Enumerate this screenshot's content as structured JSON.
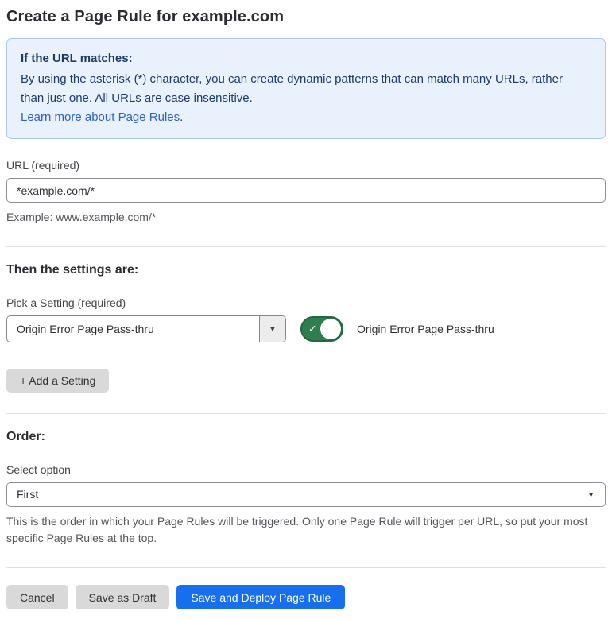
{
  "page": {
    "title": "Create a Page Rule for example.com"
  },
  "info_box": {
    "heading": "If the URL matches:",
    "body": "By using the asterisk (*) character, you can create dynamic patterns that can match many URLs, rather than just one. All URLs are case insensitive.",
    "link_label": "Learn more about Page Rules",
    "link_suffix": "."
  },
  "url_field": {
    "label": "URL (required)",
    "value": "*example.com/*",
    "helper": "Example: www.example.com/*"
  },
  "settings_section": {
    "heading": "Then the settings are:",
    "picker_label": "Pick a Setting (required)",
    "picker_value": "Origin Error Page Pass-thru",
    "toggle_label": "Origin Error Page Pass-thru",
    "toggle_state": "on",
    "add_setting_label": "+ Add a Setting"
  },
  "order_section": {
    "heading": "Order:",
    "select_label": "Select option",
    "select_value": "First",
    "helper": "This is the order in which your Page Rules will be triggered. Only one Page Rule will trigger per URL, so put your most specific Page Rules at the top."
  },
  "footer": {
    "cancel_label": "Cancel",
    "save_draft_label": "Save as Draft",
    "save_deploy_label": "Save and Deploy Page Rule"
  },
  "icons": {
    "dropdown_arrow": "▼",
    "select_arrow": "▼",
    "toggle_check": "✓"
  },
  "colors": {
    "accent_blue": "#166fee",
    "toggle_green": "#2f7e52",
    "info_bg": "#e9f2fc",
    "info_border": "#abc9ea",
    "info_text": "#1e3a68",
    "link_blue": "#2b62c8",
    "button_gray": "#d9d9d9"
  }
}
